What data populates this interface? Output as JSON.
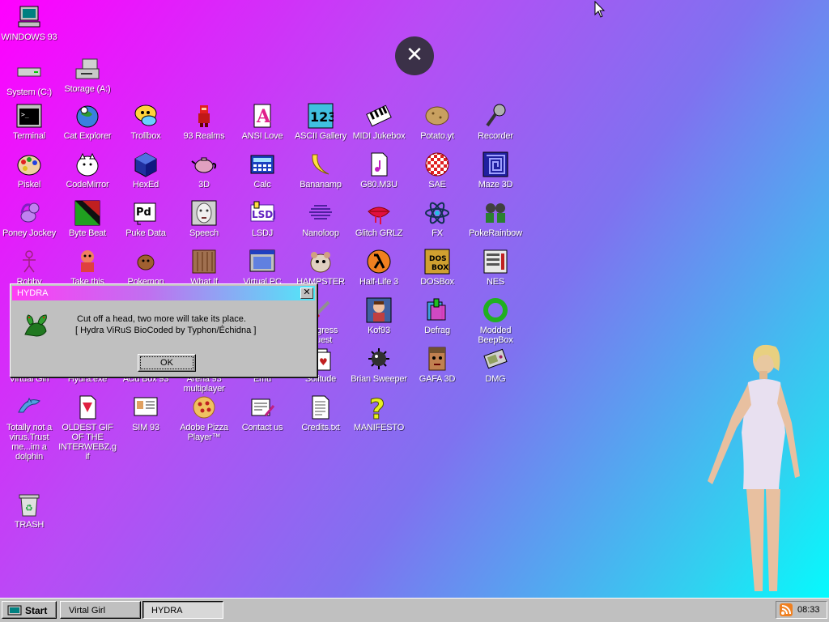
{
  "desktop": {
    "icons": [
      {
        "label": "WINDOWS 93",
        "icon": "computer-icon"
      },
      {
        "label": "System (C:)",
        "icon": "drive-icon"
      },
      {
        "label": "Storage (A:)",
        "icon": "floppy-drive-icon"
      },
      {
        "label": "Terminal",
        "icon": "terminal-icon"
      },
      {
        "label": "Cat Explorer",
        "icon": "cat-globe-icon"
      },
      {
        "label": "Trollbox",
        "icon": "chat-bubble-icon"
      },
      {
        "label": "93 Realms",
        "icon": "knight-icon"
      },
      {
        "label": "ANSI Love",
        "icon": "ansi-letter-icon"
      },
      {
        "label": "ASCII Gallery",
        "icon": "ascii-numbers-icon"
      },
      {
        "label": "MIDI Jukebox",
        "icon": "piano-keys-icon"
      },
      {
        "label": "Potato.yt",
        "icon": "potato-icon"
      },
      {
        "label": "Recorder",
        "icon": "microphone-icon"
      },
      {
        "label": "Piskel",
        "icon": "palette-icon"
      },
      {
        "label": "CodeMirror",
        "icon": "cat-mirror-icon"
      },
      {
        "label": "HexEd",
        "icon": "cube-icon"
      },
      {
        "label": "3D",
        "icon": "teapot-icon"
      },
      {
        "label": "Calc",
        "icon": "calculator-icon"
      },
      {
        "label": "Bananamp",
        "icon": "banana-icon"
      },
      {
        "label": "G80.M3U",
        "icon": "music-file-icon"
      },
      {
        "label": "SAE",
        "icon": "checkered-ball-icon"
      },
      {
        "label": "Maze 3D",
        "icon": "maze-icon"
      },
      {
        "label": "Poney Jockey",
        "icon": "pony-icon"
      },
      {
        "label": "Byte Beat",
        "icon": "bytebeat-icon"
      },
      {
        "label": "Puke Data",
        "icon": "pd-icon"
      },
      {
        "label": "Speech",
        "icon": "speech-face-icon"
      },
      {
        "label": "LSDJ",
        "icon": "lsdj-icon"
      },
      {
        "label": "Nanoloop",
        "icon": "nanoloop-icon"
      },
      {
        "label": "Glitch GRLZ",
        "icon": "lips-icon"
      },
      {
        "label": "FX",
        "icon": "atom-icon"
      },
      {
        "label": "PokeRainbow",
        "icon": "pokerainbow-icon"
      },
      {
        "label": "Robby",
        "icon": "stick-figure-icon"
      },
      {
        "label": "Take this",
        "icon": "mascot-icon"
      },
      {
        "label": "Pokemon",
        "icon": "pokemon-icon"
      },
      {
        "label": "What If",
        "icon": "what-if-icon"
      },
      {
        "label": "Virtual PC",
        "icon": "virtual-pc-icon"
      },
      {
        "label": "HAMPSTER",
        "icon": "hamster-icon"
      },
      {
        "label": "Half-Life 3",
        "icon": "lambda-icon"
      },
      {
        "label": "DOSBox",
        "icon": "dosbox-icon"
      },
      {
        "label": "NES",
        "icon": "nes-icon"
      },
      {
        "label": "Progress Quest",
        "icon": "sword-icon"
      },
      {
        "label": "Kof93",
        "icon": "fighter-icon"
      },
      {
        "label": "Defrag",
        "icon": "defrag-icon"
      },
      {
        "label": "Modded BeepBox",
        "icon": "green-ring-icon"
      },
      {
        "label": "Virtual Girl",
        "icon": "virtual-girl-icon"
      },
      {
        "label": "Hydra.exe",
        "icon": "hydra-icon"
      },
      {
        "label": "Acid Box 93",
        "icon": "acid-box-icon"
      },
      {
        "label": "Arena 93 multiplayer",
        "icon": "arena-icon"
      },
      {
        "label": "Emu",
        "icon": "emu-icon"
      },
      {
        "label": "Solitude",
        "icon": "solitude-icon"
      },
      {
        "label": "Brian Sweeper",
        "icon": "mine-icon"
      },
      {
        "label": "GAFA 3D",
        "icon": "doomguy-icon"
      },
      {
        "label": "DMG",
        "icon": "gameboy-icon"
      },
      {
        "label": "Totally not a virus.Trust me...im a dolphin",
        "icon": "dolphin-icon"
      },
      {
        "label": "OLDEST GIF OF THE INTERWEBZ.gif",
        "icon": "gif-file-icon"
      },
      {
        "label": "SIM 93",
        "icon": "sim-card-icon"
      },
      {
        "label": "Adobe Pizza Player™",
        "icon": "pizza-icon"
      },
      {
        "label": "Contact us",
        "icon": "contact-icon"
      },
      {
        "label": "Credits.txt",
        "icon": "text-file-icon"
      },
      {
        "label": "MANIFESTO",
        "icon": "question-mark-icon"
      },
      {
        "label": "TRASH",
        "icon": "recycle-bin-icon"
      }
    ]
  },
  "overlay": {
    "close_symbol": "✕"
  },
  "dialog": {
    "title": "HYDRA",
    "close_symbol": "✕",
    "message_line1": "Cut off a head, two more will take its place.",
    "message_line2": "[ Hydra ViRuS BioCoded by Typhon/Échidna ]",
    "ok_label": "OK",
    "icon": "hydra-icon"
  },
  "taskbar": {
    "start_label": "Start",
    "tasks": [
      "Virtal Girl",
      "HYDRA"
    ],
    "active_task": "HYDRA",
    "clock": "08:33",
    "tray_icon": "rss-icon"
  },
  "colors": {
    "gradient_start": "#ff00ff",
    "gradient_end": "#00ffff",
    "window_face": "#c0c0c0"
  }
}
